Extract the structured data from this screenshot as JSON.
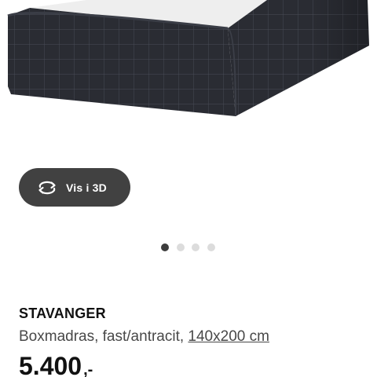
{
  "product": {
    "name": "STAVANGER",
    "description": "Boxmadras, fast/antracit, ",
    "size_link": "140x200 cm",
    "price_value": "5.400",
    "price_suffix": ",-"
  },
  "view_3d": {
    "label": "Vis i 3D",
    "icon": "rotate-icon"
  },
  "carousel": {
    "dots": [
      {
        "active": true
      },
      {
        "active": false
      },
      {
        "active": false
      },
      {
        "active": false
      }
    ]
  },
  "colors": {
    "mattress_fabric": "#2a2c33",
    "mattress_top": "#eeeeee",
    "button_bg": "#414141",
    "dot_active": "#3d3d3d",
    "dot_inactive": "#dcdcdc"
  }
}
